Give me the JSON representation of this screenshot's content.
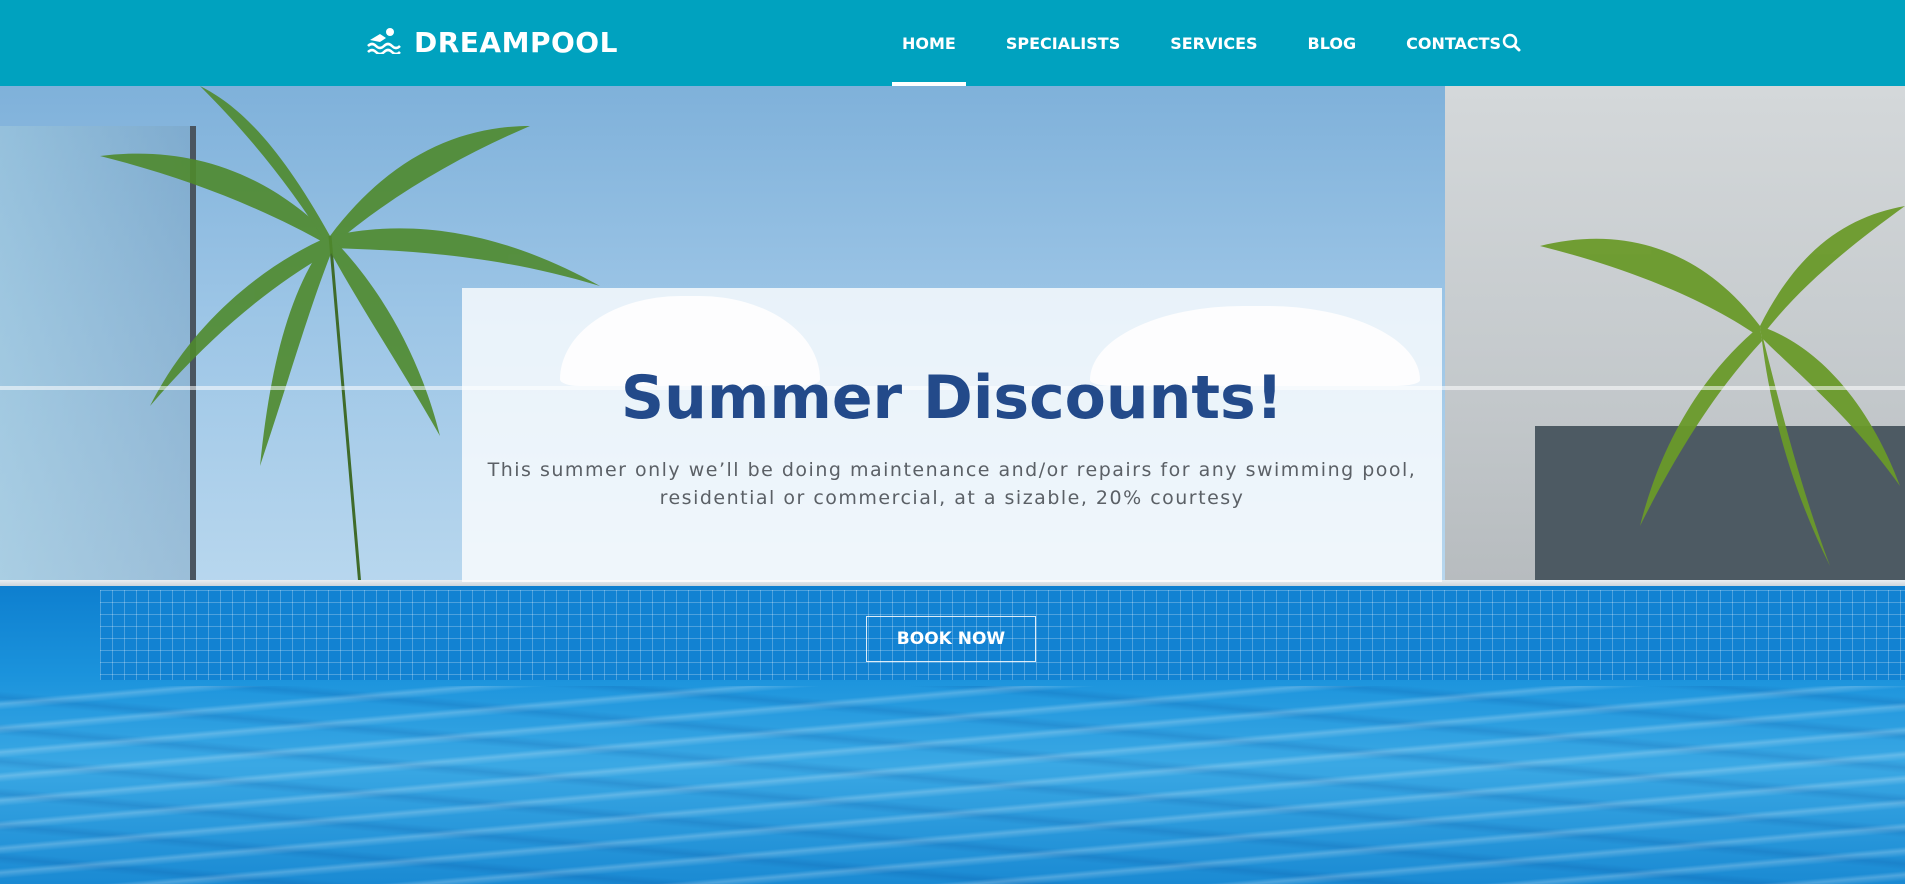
{
  "brand": {
    "name": "DREAMPOOL",
    "logo_icon": "swimmer-icon"
  },
  "nav": {
    "items": [
      {
        "label": "HOME",
        "active": true
      },
      {
        "label": "SPECIALISTS",
        "active": false
      },
      {
        "label": "SERVICES",
        "active": false
      },
      {
        "label": "BLOG",
        "active": false
      },
      {
        "label": "CONTACTS",
        "active": false
      }
    ],
    "search_icon": "search-icon"
  },
  "hero": {
    "title": "Summer Discounts!",
    "text": "This summer only we’ll be doing maintenance and/or repairs for any swimming pool, residential or commercial, at a sizable, 20% courtesy",
    "button_label": "BOOK NOW"
  },
  "colors": {
    "header_bg": "#00a2bf",
    "title": "#234a8a",
    "body_text": "#5b6066"
  }
}
